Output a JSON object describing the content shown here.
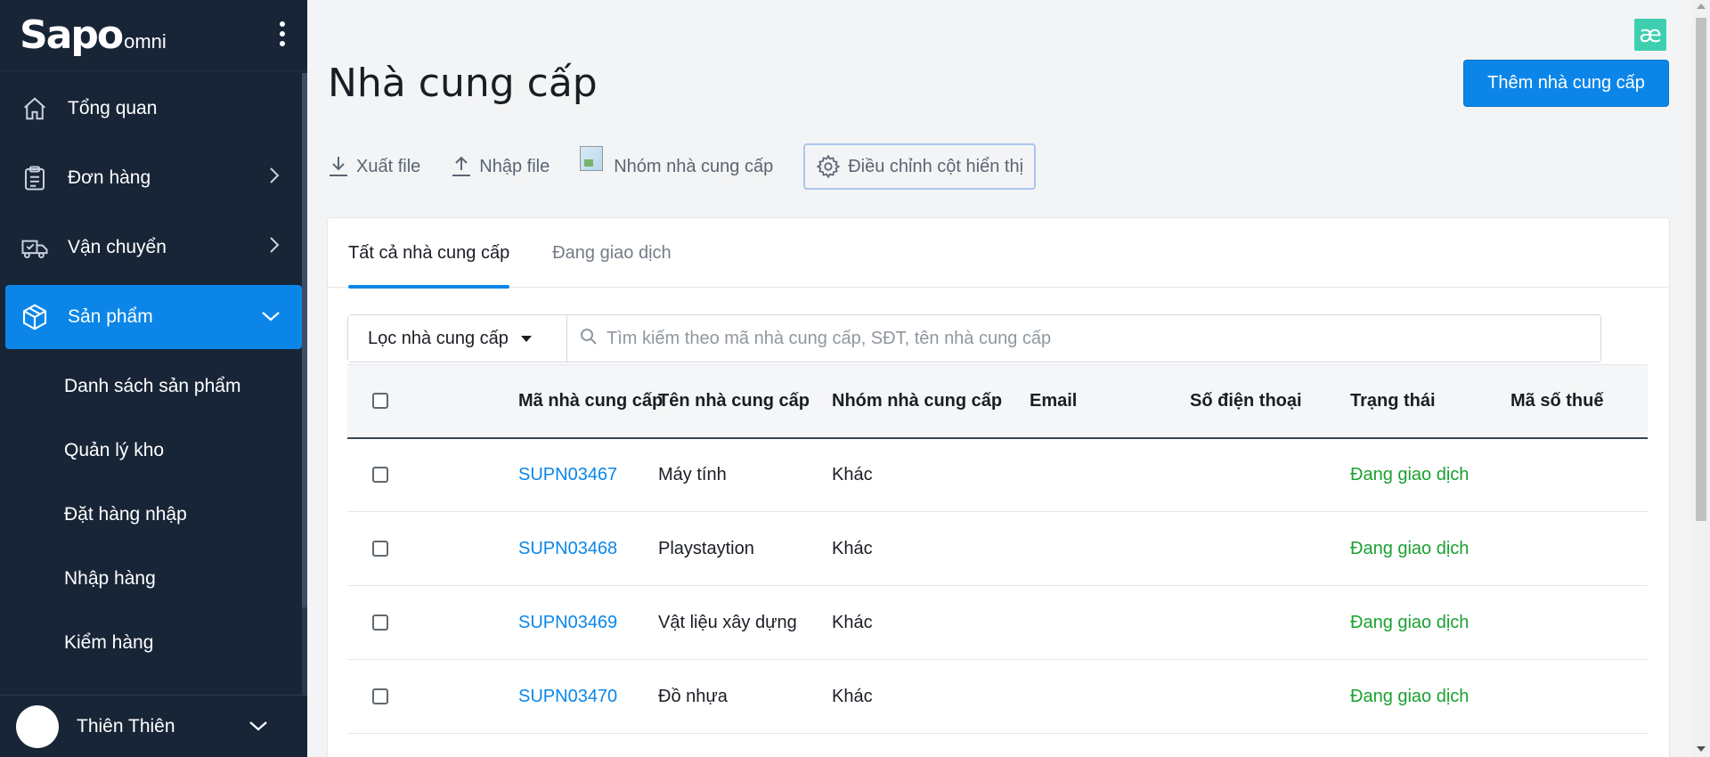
{
  "brand": {
    "logo_text": "Sapo",
    "logo_suffix": "omni"
  },
  "sidebar": {
    "items": [
      {
        "label": "Tổng quan",
        "icon": "home-icon",
        "has_chevron": false
      },
      {
        "label": "Đơn hàng",
        "icon": "clipboard-icon",
        "has_chevron": true
      },
      {
        "label": "Vận chuyển",
        "icon": "truck-icon",
        "has_chevron": true
      },
      {
        "label": "Sản phẩm",
        "icon": "box-icon",
        "has_chevron": true,
        "active": true
      }
    ],
    "sub_items": [
      {
        "label": "Danh sách sản phẩm"
      },
      {
        "label": "Quản lý kho"
      },
      {
        "label": "Đặt hàng nhập"
      },
      {
        "label": "Nhập hàng"
      },
      {
        "label": "Kiểm hàng"
      }
    ],
    "user": {
      "name": "Thiên Thiên"
    }
  },
  "header": {
    "title": "Nhà cung cấp",
    "badge": "æ",
    "primary_button": "Thêm nhà cung cấp"
  },
  "toolbar": {
    "export_label": "Xuất file",
    "import_label": "Nhập file",
    "group_label": "Nhóm nhà cung cấp",
    "columns_label": "Điều chỉnh cột hiển thị"
  },
  "tabs": [
    {
      "label": "Tất cả nhà cung cấp",
      "active": true
    },
    {
      "label": "Đang giao dịch",
      "active": false
    }
  ],
  "filter": {
    "button_label": "Lọc nhà cung cấp",
    "search_placeholder": "Tìm kiếm theo mã nhà cung cấp, SĐT, tên nhà cung cấp"
  },
  "table": {
    "columns": [
      "Mã nhà cung cấp",
      "Tên nhà cung cấp",
      "Nhóm nhà cung cấp",
      "Email",
      "Số điện thoại",
      "Trạng thái",
      "Mã số thuế"
    ],
    "rows": [
      {
        "code": "SUPN03467",
        "name": "Máy tính",
        "group": "Khác",
        "email": "",
        "phone": "",
        "status": "Đang giao dịch",
        "tax": ""
      },
      {
        "code": "SUPN03468",
        "name": "Playstaytion",
        "group": "Khác",
        "email": "",
        "phone": "",
        "status": "Đang giao dịch",
        "tax": ""
      },
      {
        "code": "SUPN03469",
        "name": "Vật liệu xây dựng",
        "group": "Khác",
        "email": "",
        "phone": "",
        "status": "Đang giao dịch",
        "tax": ""
      },
      {
        "code": "SUPN03470",
        "name": "Đồ nhựa",
        "group": "Khác",
        "email": "",
        "phone": "",
        "status": "Đang giao dịch",
        "tax": ""
      }
    ]
  },
  "colors": {
    "sidebar_bg": "#182537",
    "accent": "#0b86e8",
    "status_green": "#1aa130",
    "badge_teal": "#3ecfb0"
  }
}
